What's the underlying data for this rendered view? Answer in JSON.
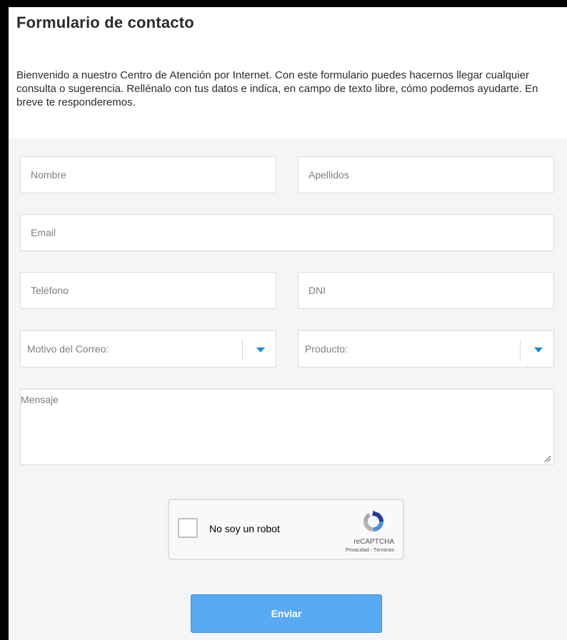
{
  "header": {
    "title": "Formulario de contacto",
    "intro": "Bienvenido a nuestro Centro de Atención por Internet. Con este formulario puedes hacernos llegar cualquier consulta o sugerencia. Rellénalo con tus datos e indica, en campo de texto libre, cómo podemos ayudarte. En breve te responderemos."
  },
  "form": {
    "nombre": {
      "placeholder": "Nombre",
      "value": ""
    },
    "apellidos": {
      "placeholder": "Apellidos",
      "value": ""
    },
    "email": {
      "placeholder": "Email",
      "value": ""
    },
    "telefono": {
      "placeholder": "Teléfono",
      "value": ""
    },
    "dni": {
      "placeholder": "DNI",
      "value": ""
    },
    "motivo": {
      "label": "Motivo del Correo:",
      "icon": "caret-down-icon"
    },
    "producto": {
      "label": "Producto:",
      "icon": "caret-down-icon"
    },
    "mensaje": {
      "placeholder": "Mensaje",
      "value": ""
    }
  },
  "captcha": {
    "label": "No soy un robot",
    "brand": "reCAPTCHA",
    "links": "Privacidad - Términos",
    "checked": false,
    "icon": "recaptcha-logo-icon"
  },
  "submit": {
    "label": "Enviar"
  },
  "colors": {
    "accent": "#1a88d8",
    "button": "#5aa9f5",
    "form_background": "#f4f5f6",
    "frame_border": "#000000"
  }
}
